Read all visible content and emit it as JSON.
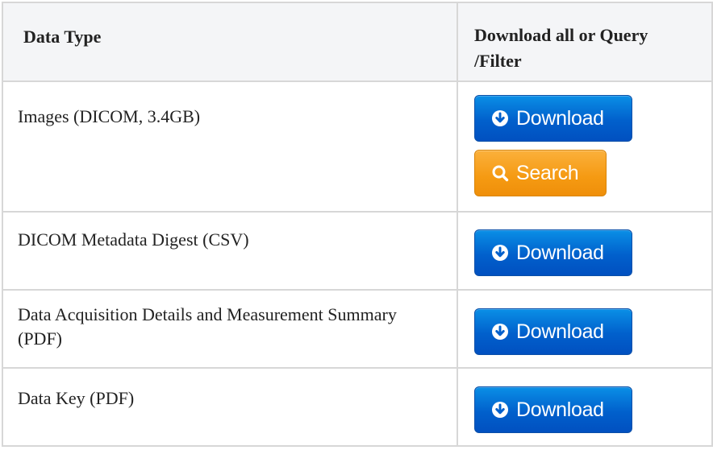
{
  "table": {
    "headers": {
      "type": "Data Type",
      "download": "Download all or Query /Filter"
    },
    "rows": [
      {
        "type": "Images (DICOM, 3.4GB)",
        "download_label": "Download",
        "search_label": "Search"
      },
      {
        "type": "DICOM Metadata Digest (CSV)",
        "download_label": "Download"
      },
      {
        "type": "Data Acquisition Details and Measurement Summary (PDF)",
        "download_label": "Download"
      },
      {
        "type": "Data Key (PDF)",
        "download_label": "Download"
      }
    ]
  },
  "icons": {
    "download": "circle-arrow-down-icon",
    "search": "magnifier-search-icon"
  },
  "colors": {
    "download_button": "#0160cc",
    "search_button": "#f59a12",
    "header_background": "#f4f5f7",
    "border": "#d7d7d7"
  }
}
